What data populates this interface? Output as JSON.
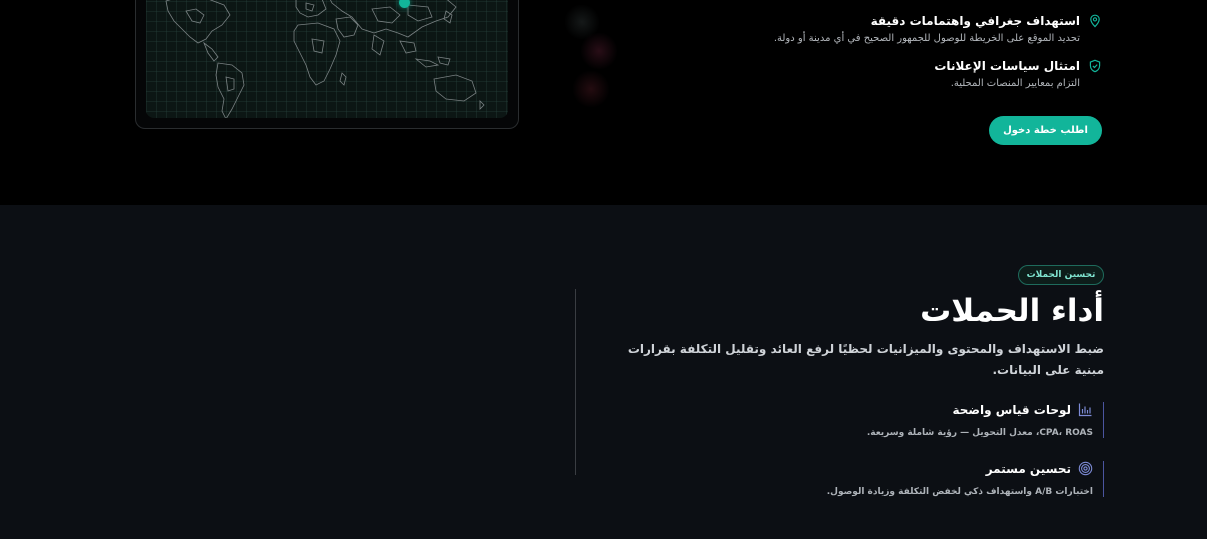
{
  "top": {
    "features": [
      {
        "title": "استهداف جغرافي واهتمامات دقيقة",
        "desc": "تحديد الموقع على الخريطة للوصول للجمهور الصحيح في أي مدينة أو دولة.",
        "icon": "location-pin-icon"
      },
      {
        "title": "امتثال سياسات الإعلانات",
        "desc": "التزام بمعايير المنصات المحلية.",
        "icon": "shield-check-icon"
      }
    ],
    "cta_label": "اطلب خطة دخول"
  },
  "campaign": {
    "tag": "تحسين الحملات",
    "title": "أداء الحملات",
    "desc": "ضبط الاستهداف والمحتوى والميزانيات لحظيًا لرفع العائد وتقليل التكلفة بقرارات مبنية على البيانات.",
    "items": [
      {
        "title": "لوحات قياس واضحة",
        "desc": "CPA، ROAS، معدل التحويل — رؤية شاملة وسريعة.",
        "icon": "bar-chart-icon"
      },
      {
        "title": "تحسين مستمر",
        "desc": "اختبارات A/B واستهداف ذكي لخفض التكلفة وزيادة الوصول.",
        "icon": "target-icon"
      }
    ]
  },
  "colors": {
    "accent": "#12b59a",
    "background_top": "#000000",
    "background_bottom": "#0c0f14",
    "item_border": "#4b55a0"
  }
}
